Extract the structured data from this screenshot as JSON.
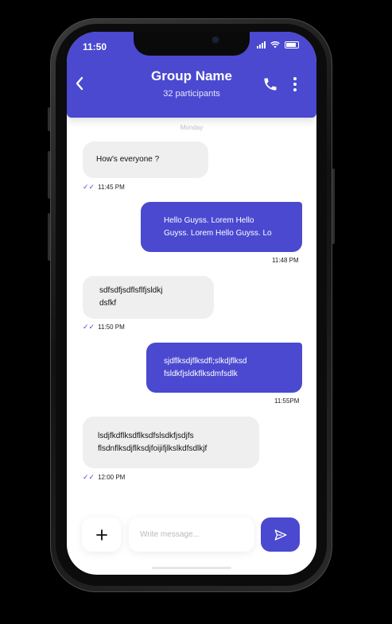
{
  "status": {
    "time": "11:50"
  },
  "header": {
    "title": "Group Name",
    "participants": "32 participants"
  },
  "chat": {
    "day": "Monday",
    "messages": [
      {
        "text_lines": [
          "How's everyone ?"
        ],
        "time": "11:45 PM"
      },
      {
        "text_lines": [
          "Hello Guyss. Lorem Hello",
          "Guyss. Lorem Hello Guyss. Lo"
        ],
        "time": "11:48 PM"
      },
      {
        "text_lines": [
          "sdfsdfjsdflsflfjsldkj",
          "dsfkf"
        ],
        "time": "11:50 PM"
      },
      {
        "text_lines": [
          "sjdflksdjflksdfl;slkdjflksd",
          "fsldkfjsldkflksdmfsdlk"
        ],
        "time": "11:55PM"
      },
      {
        "text_lines": [
          "lsdjfkdflksdflksdfslsdkfjsdjfs",
          "flsdnflksdjflksdjfoijifjlkslkdfsdlkjf"
        ],
        "time": "12:00 PM"
      }
    ]
  },
  "composer": {
    "placeholder": "Write message..."
  },
  "colors": {
    "accent": "#4a49d0",
    "incoming_bubble": "#efefef"
  },
  "icons": [
    "back-arrow-icon",
    "phone-icon",
    "more-vertical-icon",
    "double-check-icon",
    "plus-icon",
    "send-icon"
  ]
}
